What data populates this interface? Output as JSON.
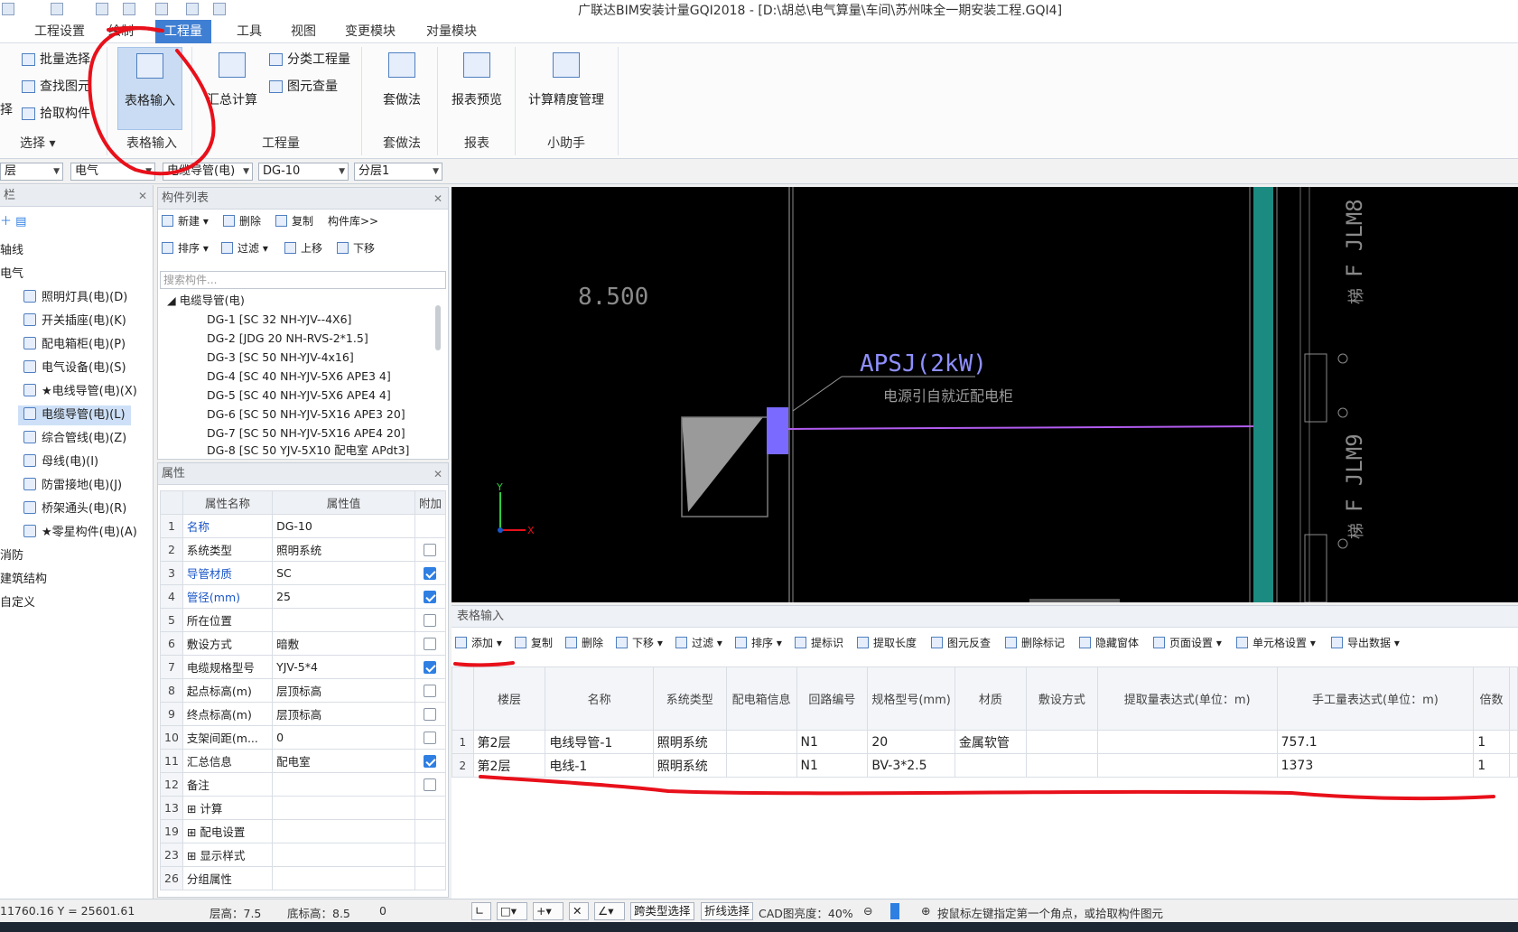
{
  "window": {
    "title": "广联达BIM安装计量GQI2018 - [D:\\胡总\\电气算量\\车间\\苏州味全一期安装工程.GQI4]"
  },
  "menu": [
    "工程设置",
    "绘制",
    "工程量",
    "工具",
    "视图",
    "变更模块",
    "对量模块"
  ],
  "ribbon": {
    "select_items": [
      "批量选择",
      "查找图元",
      "拾取构件"
    ],
    "select_edge_label": "择",
    "select_group": "选择",
    "table_input_btn": "表格输入",
    "table_input_group": "表格输入",
    "summary_btn": "汇总计算",
    "quantity_items": [
      "分类工程量",
      "图元查量"
    ],
    "quantity_group": "工程量",
    "method_btn": "套做法",
    "method_group": "套做法",
    "report_btn": "报表预览",
    "report_group": "报表",
    "precision_btn": "计算精度管理",
    "precision_group": "小助手"
  },
  "combos": [
    "层",
    "电气",
    "电缆导管(电)",
    "DG-10",
    "分层1"
  ],
  "left_panel": {
    "header": "栏",
    "nodes": [
      "轴线",
      "电气",
      "照明灯具(电)(D)",
      "开关插座(电)(K)",
      "配电箱柜(电)(P)",
      "电气设备(电)(S)",
      "★电线导管(电)(X)",
      "电缆导管(电)(L)",
      "综合管线(电)(Z)",
      "母线(电)(I)",
      "防雷接地(电)(J)",
      "桥架通头(电)(R)",
      "★零星构件(电)(A)",
      "消防",
      "建筑结构",
      "自定义"
    ]
  },
  "component_list": {
    "header": "构件列表",
    "toolbar1": [
      "新建",
      "删除",
      "复制",
      "构件库>>"
    ],
    "toolbar2": [
      "排序",
      "过滤",
      "上移",
      "下移"
    ],
    "search_placeholder": "搜索构件...",
    "group": "电缆导管(电)",
    "items": [
      "DG-1 [SC 32 NH-YJV--4X6]",
      "DG-2 [JDG 20 NH-RVS-2*1.5]",
      "DG-3 [SC 50 NH-YJV-4x16]",
      "DG-4 [SC 40 NH-YJV-5X6 APE3 4]",
      "DG-5 [SC 40 NH-YJV-5X6 APE4 4]",
      "DG-6 [SC 50 NH-YJV-5X16 APE3 20]",
      "DG-7 [SC 50 NH-YJV-5X16 APE4 20]",
      "DG-8 [SC 50 YJV-5X10 配电室 APdt3]"
    ]
  },
  "properties": {
    "header": "属性",
    "columns": [
      "属性名称",
      "属性值",
      "附加"
    ],
    "rows": [
      {
        "n": "1",
        "name": "名称",
        "value": "DG-10",
        "blue": true,
        "check": null
      },
      {
        "n": "2",
        "name": "系统类型",
        "value": "照明系统",
        "blue": false,
        "check": false
      },
      {
        "n": "3",
        "name": "导管材质",
        "value": "SC",
        "blue": true,
        "check": true
      },
      {
        "n": "4",
        "name": "管径(mm)",
        "value": "25",
        "blue": true,
        "check": true
      },
      {
        "n": "5",
        "name": "所在位置",
        "value": "",
        "blue": false,
        "check": false
      },
      {
        "n": "6",
        "name": "敷设方式",
        "value": "暗敷",
        "blue": false,
        "check": false
      },
      {
        "n": "7",
        "name": "电缆规格型号",
        "value": "YJV-5*4",
        "blue": false,
        "check": true
      },
      {
        "n": "8",
        "name": "起点标高(m)",
        "value": "层顶标高",
        "blue": false,
        "check": false
      },
      {
        "n": "9",
        "name": "终点标高(m)",
        "value": "层顶标高",
        "blue": false,
        "check": false
      },
      {
        "n": "10",
        "name": "支架间距(m...",
        "value": "0",
        "blue": false,
        "check": false
      },
      {
        "n": "11",
        "name": "汇总信息",
        "value": "配电室",
        "blue": false,
        "check": true
      },
      {
        "n": "12",
        "name": "备注",
        "value": "",
        "blue": false,
        "check": false
      },
      {
        "n": "13",
        "name": "计算",
        "value": "",
        "blue": false,
        "check": null,
        "expand": true
      },
      {
        "n": "19",
        "name": "配电设置",
        "value": "",
        "blue": false,
        "check": null,
        "expand": true
      },
      {
        "n": "23",
        "name": "显示样式",
        "value": "",
        "blue": false,
        "check": null,
        "expand": true
      },
      {
        "n": "26",
        "name": "分组属性",
        "value": "",
        "blue": false,
        "check": null
      }
    ]
  },
  "cad": {
    "elevation": "8.500",
    "label_main": "APSJ(2kW)",
    "label_sub": "电源引自就近配电柜",
    "side_label_1": "F JLM8",
    "side_label_2": "F JLM9",
    "side_char": "梯",
    "axis_y": "Y",
    "axis_x": "X"
  },
  "table_input": {
    "header": "表格输入",
    "toolbar": [
      "添加",
      "复制",
      "删除",
      "下移",
      "过滤",
      "排序",
      "提标识",
      "提取长度",
      "图元反查",
      "删除标记",
      "隐藏窗体",
      "页面设置",
      "单元格设置",
      "导出数据"
    ],
    "columns": [
      "楼层",
      "名称",
      "系统类型",
      "配电箱信息",
      "回路编号",
      "规格型号(mm)",
      "材质",
      "敷设方式",
      "提取量表达式(单位：m)",
      "手工量表达式(单位：m)",
      "倍数"
    ],
    "rows": [
      {
        "n": "1",
        "cells": [
          "第2层",
          "电线导管-1",
          "照明系统",
          "",
          "N1",
          "20",
          "金属软管",
          "",
          "",
          "757.1",
          "1"
        ]
      },
      {
        "n": "2",
        "cells": [
          "第2层",
          "电线-1",
          "照明系统",
          "",
          "N1",
          "BV-3*2.5",
          "",
          "",
          "",
          "1373",
          "1"
        ]
      }
    ]
  },
  "status": {
    "coords": "11760.16 Y = 25601.61",
    "floor_height": "层高：7.5",
    "bottom_elev": "底标高：8.5",
    "zero": "0",
    "btn_cross_type": "跨类型选择",
    "btn_polyline": "折线选择",
    "cad_brightness": "CAD图亮度：40%",
    "hint": "按鼠标左键指定第一个角点，或拾取构件图元"
  },
  "colors": {
    "accent": "#3f7fd3",
    "annotation": "#e8101a",
    "cad_bg": "#000000",
    "cad_line": "#b25cf0",
    "cad_text": "#8f8fff"
  }
}
